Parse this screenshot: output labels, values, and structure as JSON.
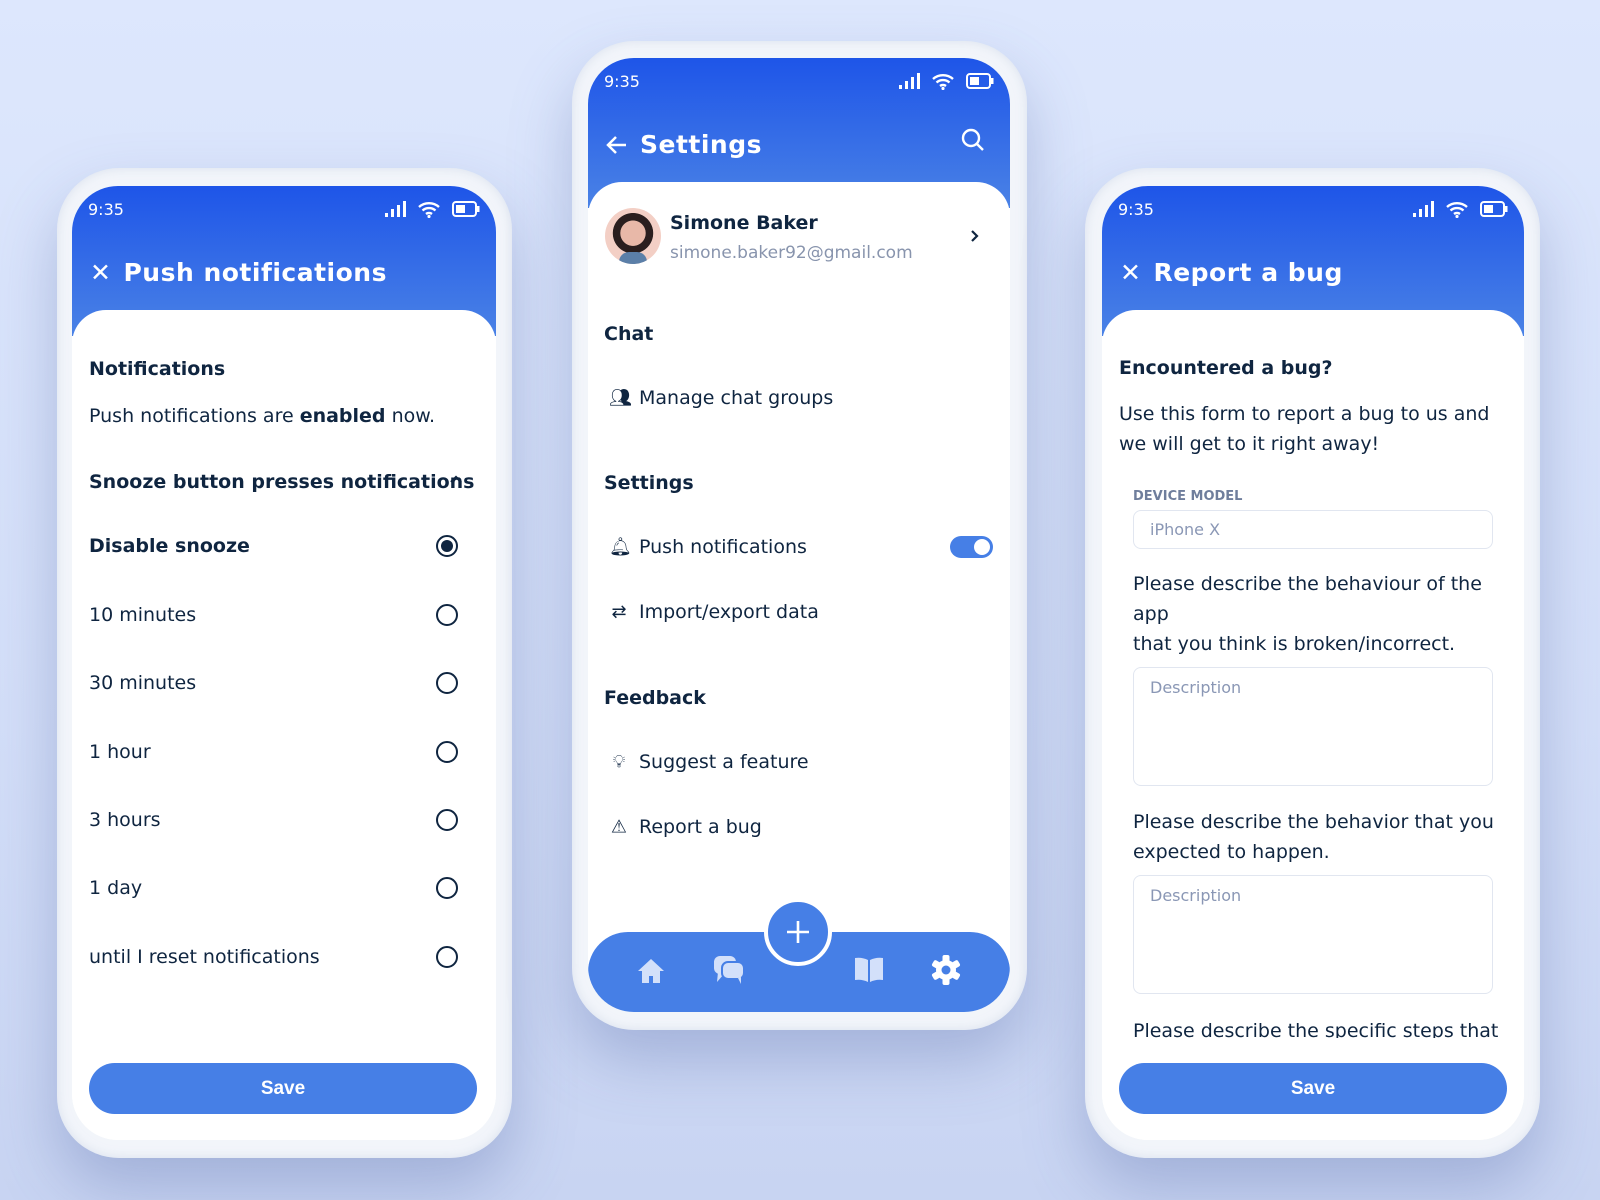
{
  "status": {
    "time": "9:35"
  },
  "left": {
    "title": "Push notifications",
    "section": "Notifications",
    "status_prefix": "Push notifications are ",
    "status_bold": "enabled",
    "status_suffix": " now.",
    "snooze_header": "Snooze button presses notifications",
    "options": [
      {
        "label": "Disable snooze",
        "selected": true
      },
      {
        "label": "10 minutes",
        "selected": false
      },
      {
        "label": "30 minutes",
        "selected": false
      },
      {
        "label": "1 hour",
        "selected": false
      },
      {
        "label": "3 hours",
        "selected": false
      },
      {
        "label": "1 day",
        "selected": false
      },
      {
        "label": "until I reset notifications",
        "selected": false
      }
    ],
    "save": "Save"
  },
  "center": {
    "title": "Settings",
    "profile": {
      "name": "Simone Baker",
      "email": "simone.baker92@gmail.com"
    },
    "chat_heading": "Chat",
    "manage": "Manage chat groups",
    "settings_heading": "Settings",
    "push": "Push notifications",
    "push_on": true,
    "import": "Import/export data",
    "feedback_heading": "Feedback",
    "suggest": "Suggest a feature",
    "report": "Report a bug",
    "nav": [
      "home-icon",
      "chat-icon",
      "book-icon",
      "gear-icon"
    ],
    "accent": "#467fe6"
  },
  "right": {
    "title": "Report a bug",
    "heading": "Encountered a bug?",
    "intro": "Use this form to report a bug to us and we will get to it right away!",
    "device_label": "DEVICE MODEL",
    "device_placeholder": "iPhone X",
    "q1_line1": "Please describe the behaviour of the",
    "q1_line2": "app",
    "q1_line3": "that you think is broken/incorrect.",
    "desc_placeholder": "Description",
    "q2": "Please describe the behavior that you expected to happen.",
    "q3": "Please describe the specific steps that",
    "save": "Save"
  }
}
